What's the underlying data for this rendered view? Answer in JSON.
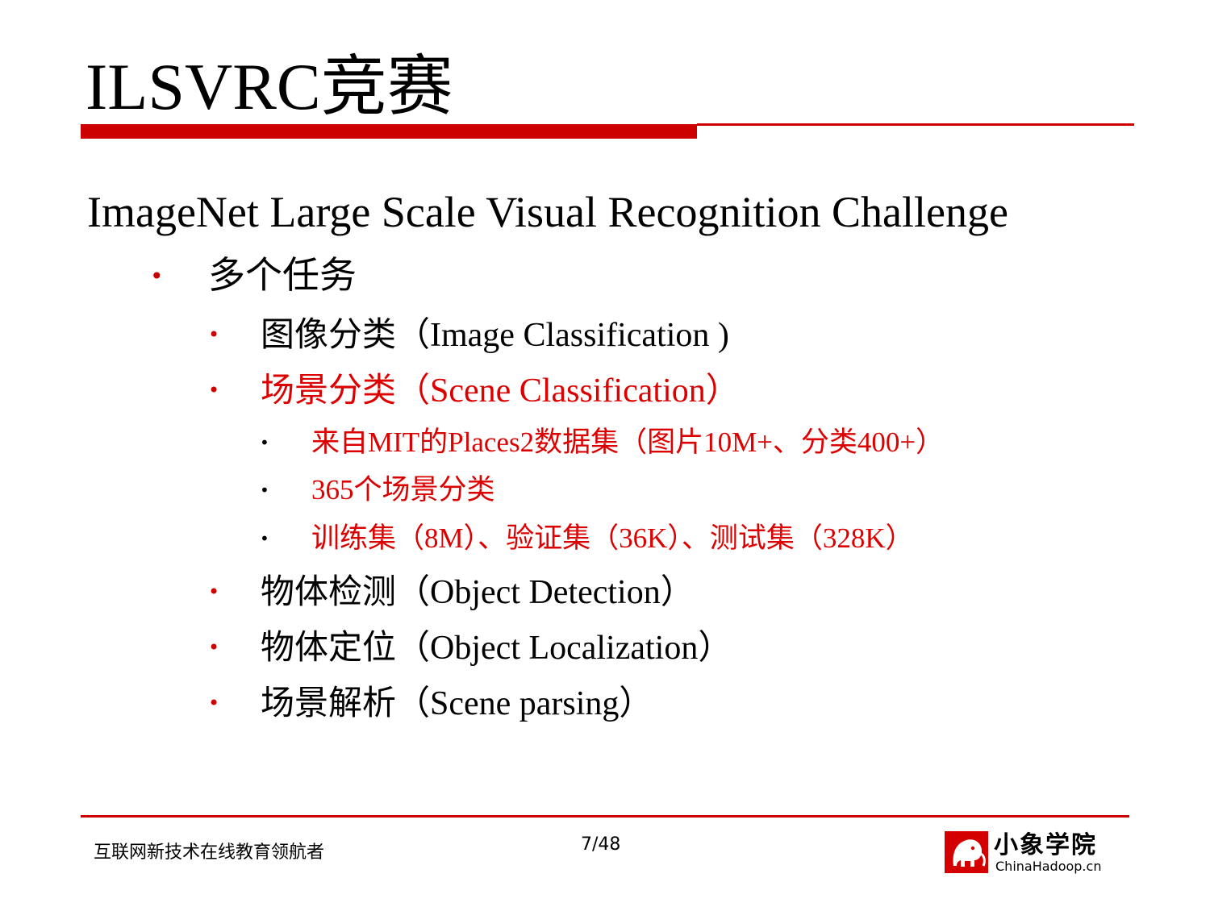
{
  "slide": {
    "title": "ILSVRC竞赛",
    "subtitle": "ImageNet Large Scale Visual Recognition Challenge",
    "bullet_glyph": "•",
    "items": [
      {
        "level": 1,
        "text": "多个任务",
        "highlight": false
      },
      {
        "level": 2,
        "text": "图像分类（Image Classification )",
        "highlight": false
      },
      {
        "level": 2,
        "text": "场景分类（Scene Classification）",
        "highlight": true
      },
      {
        "level": 3,
        "text": "来自MIT的Places2数据集（图片10M+、分类400+）",
        "highlight": true
      },
      {
        "level": 3,
        "text": "365个场景分类",
        "highlight": true
      },
      {
        "level": 3,
        "text": "训练集（8M）、验证集（36K）、测试集（328K）",
        "highlight": true
      },
      {
        "level": 2,
        "text": "物体检测（Object Detection）",
        "highlight": false
      },
      {
        "level": 2,
        "text": "物体定位（Object Localization）",
        "highlight": false
      },
      {
        "level": 2,
        "text": "场景解析（Scene parsing）",
        "highlight": false
      }
    ]
  },
  "footer": {
    "tagline": "互联网新技术在线教育领航者",
    "page_number": "7/48",
    "logo_cn": "小象学院",
    "logo_en": "ChinaHadoop.cn"
  },
  "colors": {
    "accent": "#cc0000",
    "highlight_text": "#dd0000"
  },
  "icons": {
    "logo_mark": "elephant-logo-icon"
  }
}
